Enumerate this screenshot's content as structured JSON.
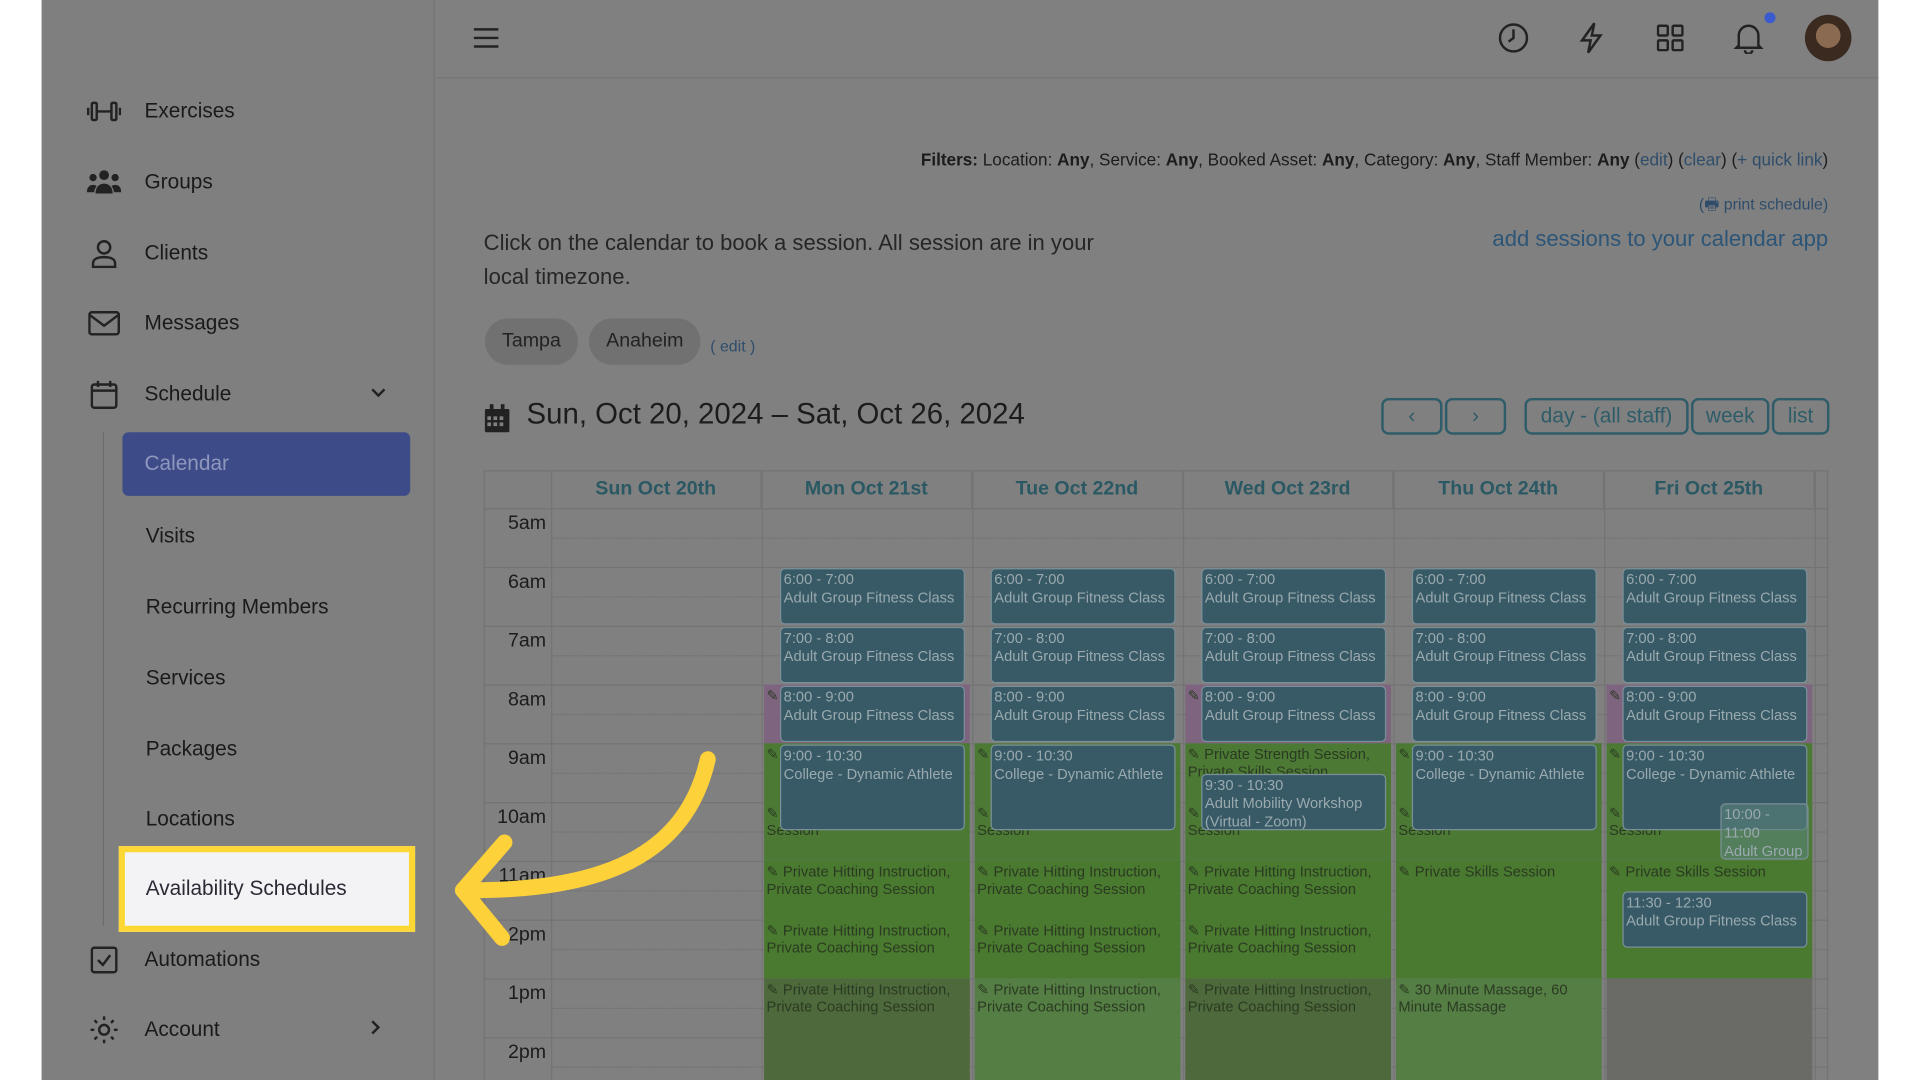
{
  "sidebar": {
    "items": [
      {
        "label": "Exercises",
        "icon": "dumbbell-icon"
      },
      {
        "label": "Groups",
        "icon": "users-icon"
      },
      {
        "label": "Clients",
        "icon": "user-icon"
      },
      {
        "label": "Messages",
        "icon": "envelope-icon"
      },
      {
        "label": "Schedule",
        "icon": "calendar-icon"
      }
    ],
    "schedule_sub": [
      "Calendar",
      "Visits",
      "Recurring Members",
      "Services",
      "Packages",
      "Locations",
      "Availability Schedules"
    ],
    "active_sub": "Calendar",
    "highlighted_sub": "Availability Schedules",
    "automations": "Automations",
    "account": "Account"
  },
  "topbar": {
    "icons": [
      "menu-icon",
      "clock-icon",
      "bolt-icon",
      "apps-grid-icon",
      "bell-icon",
      "avatar"
    ],
    "notification_dot_color": "#3a5bd0"
  },
  "filters": {
    "label": "Filters:",
    "location_label": "Location:",
    "location": "Any",
    "service_label": "Service:",
    "service": "Any",
    "asset_label": "Booked Asset:",
    "asset": "Any",
    "category_label": "Category:",
    "category": "Any",
    "staff_label": "Staff Member:",
    "staff": "Any",
    "edit": "edit",
    "clear": "clear",
    "quick_link": "+ quick link",
    "print": "print schedule"
  },
  "description": "Click on the calendar to book a session. All session are in your local timezone.",
  "add_sessions_link": "add sessions to your calendar app",
  "locations": [
    "Tampa",
    "Anaheim"
  ],
  "locations_edit": "edit",
  "date_range": "Sun, Oct 20, 2024 – Sat, Oct 26, 2024",
  "view_buttons": {
    "prev": "‹",
    "next": "›",
    "day": "day - (all staff)",
    "week": "week",
    "list": "list"
  },
  "hours": [
    "5am",
    "6am",
    "7am",
    "8am",
    "9am",
    "10am",
    "11am",
    "12pm",
    "1pm",
    "2pm"
  ],
  "days": [
    {
      "label": "Sun Oct 20th",
      "avail": [],
      "events": []
    },
    {
      "label": "Mon Oct 21st",
      "avail": [
        {
          "start": 8,
          "end": 9,
          "tone": "pink",
          "label": "Class"
        },
        {
          "start": 9,
          "end": 10,
          "tone": "green",
          "label": "Private Strength Session"
        },
        {
          "start": 10,
          "end": 11,
          "tone": "green",
          "label": "Session, Sports Specific Session"
        },
        {
          "start": 11,
          "end": 12,
          "tone": "green2",
          "label": "Private Hitting Instruction, Private Coaching Session"
        },
        {
          "start": 12,
          "end": 13,
          "tone": "green2",
          "label": "Private Hitting Instruction, Private Coaching Session"
        },
        {
          "start": 13,
          "end": 14.8,
          "tone": "dark",
          "label": "Private Hitting Instruction, Private Coaching Session"
        }
      ],
      "events": [
        {
          "start": 6,
          "end": 7,
          "time": "6:00 - 7:00",
          "title": "Adult Group Fitness Class"
        },
        {
          "start": 7,
          "end": 8,
          "time": "7:00 - 8:00",
          "title": "Adult Group Fitness Class"
        },
        {
          "start": 8,
          "end": 9,
          "time": "8:00 - 9:00",
          "title": "Adult Group Fitness Class"
        },
        {
          "start": 9,
          "end": 10.5,
          "time": "9:00 - 10:30",
          "title": "College - Dynamic Athlete"
        }
      ]
    },
    {
      "label": "Tue Oct 22nd",
      "avail": [
        {
          "start": 9,
          "end": 10,
          "tone": "green",
          "label": "Private Strength Session"
        },
        {
          "start": 10,
          "end": 11,
          "tone": "green",
          "label": "Session, Sports Specific Session"
        },
        {
          "start": 11,
          "end": 12,
          "tone": "green2",
          "label": "Private Hitting Instruction, Private Coaching Session"
        },
        {
          "start": 12,
          "end": 13,
          "tone": "green2",
          "label": "Private Hitting Instruction, Private Coaching Session"
        },
        {
          "start": 13,
          "end": 14.8,
          "tone": "light",
          "label": "Private Hitting Instruction, Private Coaching Session"
        }
      ],
      "events": [
        {
          "start": 6,
          "end": 7,
          "time": "6:00 - 7:00",
          "title": "Adult Group Fitness Class"
        },
        {
          "start": 7,
          "end": 8,
          "time": "7:00 - 8:00",
          "title": "Adult Group Fitness Class"
        },
        {
          "start": 8,
          "end": 9,
          "time": "8:00 - 9:00",
          "title": "Adult Group Fitness Class"
        },
        {
          "start": 9,
          "end": 10.5,
          "time": "9:00 - 10:30",
          "title": "College - Dynamic Athlete"
        }
      ]
    },
    {
      "label": "Wed Oct 23rd",
      "avail": [
        {
          "start": 8,
          "end": 9,
          "tone": "pink",
          "label": "Class"
        },
        {
          "start": 9,
          "end": 10,
          "tone": "green",
          "label": "Private Strength Session, Private Skills Session"
        },
        {
          "start": 10,
          "end": 11,
          "tone": "green",
          "label": "Session, Sports Specific Session"
        },
        {
          "start": 11,
          "end": 12,
          "tone": "green2",
          "label": "Private Hitting Instruction, Private Coaching Session"
        },
        {
          "start": 12,
          "end": 13,
          "tone": "green2",
          "label": "Private Hitting Instruction, Private Coaching Session"
        },
        {
          "start": 13,
          "end": 14.8,
          "tone": "dark",
          "label": "Private Hitting Instruction, Private Coaching Session"
        }
      ],
      "events": [
        {
          "start": 6,
          "end": 7,
          "time": "6:00 - 7:00",
          "title": "Adult Group Fitness Class"
        },
        {
          "start": 7,
          "end": 8,
          "time": "7:00 - 8:00",
          "title": "Adult Group Fitness Class"
        },
        {
          "start": 8,
          "end": 9,
          "time": "8:00 - 9:00",
          "title": "Adult Group Fitness Class"
        },
        {
          "start": 9.5,
          "end": 10.5,
          "time": "9:30 - 10:30",
          "title": "Adult Mobility Workshop (Virtual - Zoom)"
        }
      ]
    },
    {
      "label": "Thu Oct 24th",
      "avail": [
        {
          "start": 9,
          "end": 10,
          "tone": "green",
          "label": "Private Strength Session"
        },
        {
          "start": 10,
          "end": 11,
          "tone": "green",
          "label": "Session, Sports Specific Session"
        },
        {
          "start": 11,
          "end": 13,
          "tone": "green2",
          "label": "Private Skills Session"
        },
        {
          "start": 13,
          "end": 14.8,
          "tone": "light",
          "label": "30 Minute Massage, 60 Minute Massage"
        }
      ],
      "events": [
        {
          "start": 6,
          "end": 7,
          "time": "6:00 - 7:00",
          "title": "Adult Group Fitness Class"
        },
        {
          "start": 7,
          "end": 8,
          "time": "7:00 - 8:00",
          "title": "Adult Group Fitness Class"
        },
        {
          "start": 8,
          "end": 9,
          "time": "8:00 - 9:00",
          "title": "Adult Group Fitness Class"
        },
        {
          "start": 9,
          "end": 10.5,
          "time": "9:00 - 10:30",
          "title": "College - Dynamic Athlete"
        }
      ]
    },
    {
      "label": "Fri Oct 25th",
      "avail": [
        {
          "start": 8,
          "end": 9,
          "tone": "pink",
          "label": "Class"
        },
        {
          "start": 9,
          "end": 10,
          "tone": "green",
          "label": "Private Strength Session"
        },
        {
          "start": 10,
          "end": 11,
          "tone": "green",
          "label": "Session, Sports Specific Session"
        },
        {
          "start": 11,
          "end": 13,
          "tone": "green2",
          "label": "Private Skills Session"
        },
        {
          "start": 13,
          "end": 14.8,
          "tone": "gray",
          "label": ""
        }
      ],
      "events": [
        {
          "start": 6,
          "end": 7,
          "time": "6:00 - 7:00",
          "title": "Adult Group Fitness Class"
        },
        {
          "start": 7,
          "end": 8,
          "time": "7:00 - 8:00",
          "title": "Adult Group Fitness Class"
        },
        {
          "start": 8,
          "end": 9,
          "time": "8:00 - 9:00",
          "title": "Adult Group Fitness Class"
        },
        {
          "start": 9,
          "end": 10.5,
          "time": "9:00 - 10:30",
          "title": "College - Dynamic Athlete"
        },
        {
          "start": 10,
          "end": 11,
          "time": "10:00 - 11:00",
          "title": "Adult Group Fitness",
          "faded": true
        },
        {
          "start": 11.5,
          "end": 12.5,
          "time": "11:30 - 12:30",
          "title": "Adult Group Fitness Class"
        }
      ]
    }
  ],
  "colors": {
    "accent": "#3d4c88",
    "event": "#375a66",
    "highlight": "#fdd835",
    "availability": "#4a7a33"
  }
}
